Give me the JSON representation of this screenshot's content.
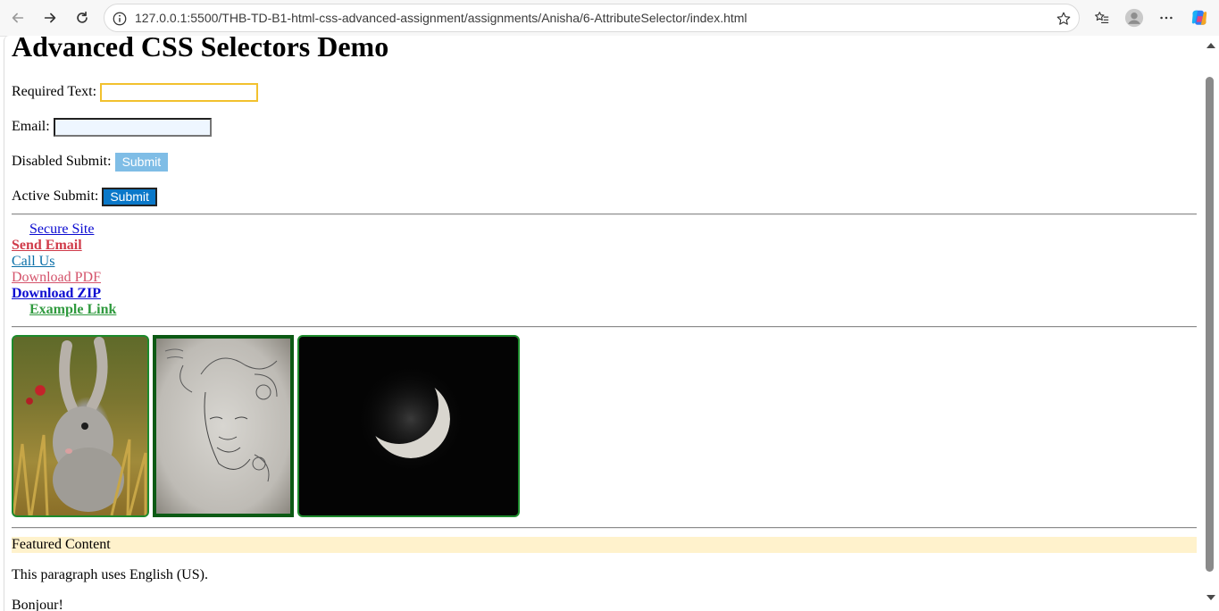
{
  "browser": {
    "url": "127.0.0.1:5500/THB-TD-B1-html-css-advanced-assignment/assignments/Anisha/6-AttributeSelector/index.html",
    "icons": [
      "back-icon",
      "forward-icon",
      "refresh-icon",
      "info-icon",
      "star-icon",
      "favorites-icon",
      "profile-icon",
      "more-icon",
      "copilot-icon"
    ]
  },
  "page": {
    "title": "Advanced CSS Selectors Demo",
    "form": {
      "required_label": "Required Text:",
      "email_label": "Email:",
      "disabled_label": "Disabled Submit:",
      "disabled_button": "Submit",
      "active_label": "Active Submit:",
      "active_button": "Submit"
    },
    "links": {
      "secure": "Secure Site",
      "email": "Send Email",
      "call": "Call Us",
      "pdf": "Download PDF",
      "zip": "Download ZIP",
      "example": "Example Link"
    },
    "images": [
      "rabbit-photo",
      "face-sketch-drawing",
      "crescent-moon-photo"
    ],
    "featured": "Featured Content",
    "english_paragraph": "This paragraph uses English (US).",
    "french_paragraph": "Bonjour!"
  },
  "colors": {
    "required_border": "#f2c12e",
    "email_bg": "#eef6ff",
    "disabled_button": "#7fbde6",
    "active_button": "#0a78c9",
    "image_border": "#1d8a2c",
    "featured_bg": "#fff2cc"
  }
}
